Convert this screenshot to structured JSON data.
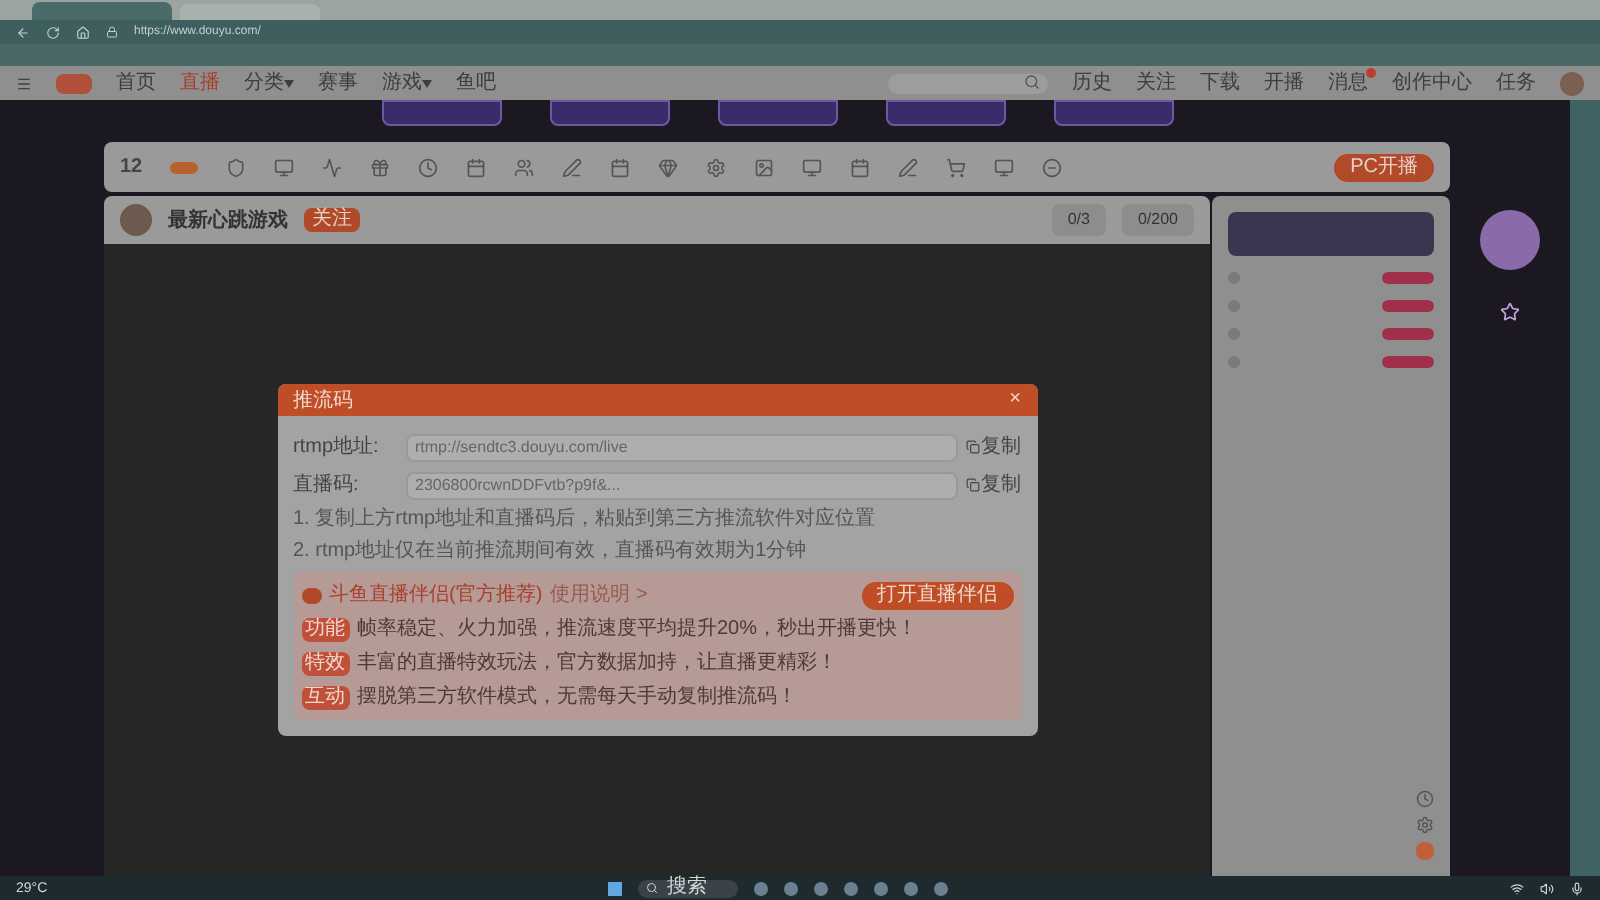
{
  "browser": {
    "tabs": [
      {
        "selected": true
      },
      {
        "selected": false
      }
    ],
    "address": "https://www.douyu.com/"
  },
  "site_nav": {
    "items": [
      {
        "label": "首页",
        "selected": false,
        "caret": false
      },
      {
        "label": "直播",
        "selected": true,
        "caret": false
      },
      {
        "label": "分类",
        "selected": false,
        "caret": true
      },
      {
        "label": "赛事",
        "selected": false,
        "caret": false
      },
      {
        "label": "游戏",
        "selected": false,
        "caret": true
      },
      {
        "label": "鱼吧",
        "selected": false,
        "caret": false
      }
    ],
    "actions": [
      {
        "label": "历史",
        "badge": false
      },
      {
        "label": "关注",
        "badge": false
      },
      {
        "label": "下载",
        "badge": false
      },
      {
        "label": "开播",
        "badge": false
      },
      {
        "label": "消息",
        "badge": true
      },
      {
        "label": "创作中心",
        "badge": false
      },
      {
        "label": "任务",
        "badge": false
      }
    ]
  },
  "toolbar": {
    "count": "12",
    "live_button": "PC开播"
  },
  "streamer": {
    "name": "最新心跳游戏",
    "follow": "关注",
    "stats": [
      "0/3",
      "0/200"
    ]
  },
  "modal": {
    "title": "推流码",
    "close": "×",
    "fields": [
      {
        "label": "rtmp地址:",
        "value": "rtmp://sendtc3.douyu.com/live",
        "action": "复制"
      },
      {
        "label": "直播码:",
        "value": "2306800rcwnDDFvtb?p9f&...",
        "action": "复制"
      }
    ],
    "notes": [
      "1. 复制上方rtmp地址和直播码后，粘贴到第三方推流软件对应位置",
      "2. rtmp地址仅在当前推流期间有效，直播码有效期为1分钟"
    ],
    "promo": {
      "title": "斗鱼直播伴侣(官方推荐)",
      "link": "使用说明 >",
      "button": "打开直播伴侣",
      "features": [
        {
          "tag": "功能",
          "text": "帧率稳定、火力加强，推流速度平均提升20%，秒出开播更快！"
        },
        {
          "tag": "特效",
          "text": "丰富的直播特效玩法，官方数据加持，让直播更精彩！"
        },
        {
          "tag": "互动",
          "text": "摆脱第三方软件模式，无需每天手动复制推流码！"
        }
      ]
    }
  },
  "taskbar": {
    "weather": "29°C",
    "search": "搜索"
  }
}
